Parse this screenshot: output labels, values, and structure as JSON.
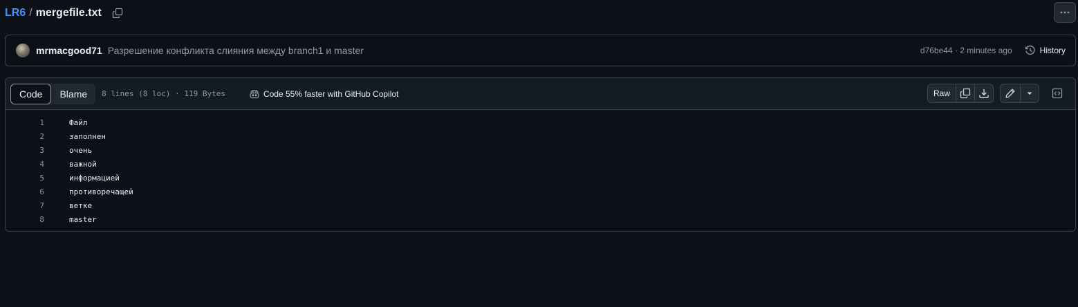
{
  "breadcrumb": {
    "repo": "LR6",
    "separator": "/",
    "file": "mergefile.txt"
  },
  "commit": {
    "author": "mrmacgood71",
    "message": "Разрешение конфликта слияния между branch1 и master",
    "sha_time": "d76be44 · 2 minutes ago",
    "history_label": "History"
  },
  "file_header": {
    "tabs": [
      {
        "label": "Code",
        "active": true
      },
      {
        "label": "Blame",
        "active": false
      }
    ],
    "meta": "8 lines (8 loc) · 119 Bytes",
    "copilot_label": "Code 55% faster with GitHub Copilot",
    "raw_label": "Raw"
  },
  "code_lines": [
    {
      "num": "1",
      "text": "Файл"
    },
    {
      "num": "2",
      "text": "заполнен"
    },
    {
      "num": "3",
      "text": "очень"
    },
    {
      "num": "4",
      "text": "важной"
    },
    {
      "num": "5",
      "text": "информацией"
    },
    {
      "num": "6",
      "text": "противоречащей"
    },
    {
      "num": "7",
      "text": "ветке"
    },
    {
      "num": "8",
      "text": "master"
    }
  ],
  "icons": {
    "copy": "copy-icon",
    "more": "kebab-horizontal-icon",
    "history": "history-icon",
    "copilot": "copilot-icon",
    "download": "download-icon",
    "edit": "pencil-icon",
    "dropdown": "triangle-down-icon",
    "symbols": "code-square-icon"
  },
  "colors": {
    "background": "#0d1117",
    "accent_link": "#4493f8",
    "muted_text": "#9198a1",
    "border": "#3d444d"
  }
}
